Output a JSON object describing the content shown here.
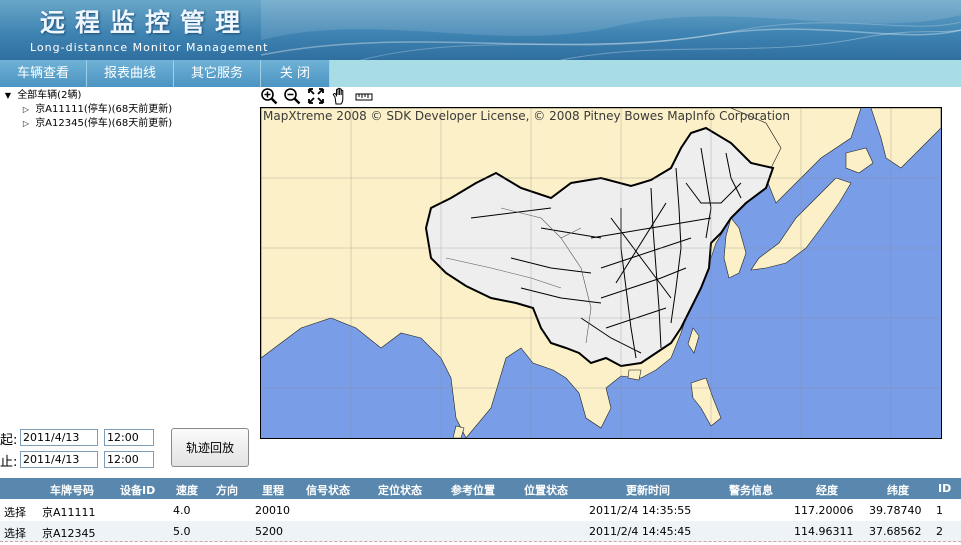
{
  "header": {
    "title": "远程监控管理",
    "subtitle": "Long-distannce Monitor Management"
  },
  "nav": [
    {
      "label": "车辆查看"
    },
    {
      "label": "报表曲线"
    },
    {
      "label": "其它服务"
    },
    {
      "label": "关 闭"
    }
  ],
  "tree": {
    "root": "全部车辆(2辆)",
    "items": [
      {
        "label": "京A11111(停车)(68天前更新)"
      },
      {
        "label": "京A12345(停车)(68天前更新)"
      }
    ]
  },
  "map": {
    "credit": "MapXtreme 2008 © SDK Developer License, © 2008 Pitney Bowes MapInfo Corporation",
    "tools": [
      "zoom-in-icon",
      "zoom-out-icon",
      "full-extent-icon",
      "pan-hand-icon",
      "ruler-icon"
    ],
    "colors": {
      "sea": "#7a9de8",
      "land": "#fbf0c8",
      "china": "#eeeeee"
    }
  },
  "form": {
    "start_label": "起:",
    "end_label": "止:",
    "start_date": "2011/4/13",
    "start_time": "12:00",
    "end_date": "2011/4/13",
    "end_time": "12:00",
    "play_label": "轨迹回放"
  },
  "table": {
    "columns": [
      "车牌号码",
      "设备ID",
      "速度",
      "方向",
      "里程",
      "信号状态",
      "定位状态",
      "参考位置",
      "位置状态",
      "更新时间",
      "警务信息",
      "经度",
      "纬度",
      "ID"
    ],
    "rows": [
      {
        "select": "选择",
        "plate": "京A11111",
        "speed": "4.0",
        "mileage": "20010",
        "time": "2011/2/4 14:35:55",
        "lng": "117.20006",
        "lat": "39.78740",
        "id": "1"
      },
      {
        "select": "选择",
        "plate": "京A12345",
        "speed": "5.0",
        "mileage": "5200",
        "time": "2011/2/4 14:45:45",
        "lng": "114.96311",
        "lat": "37.68562",
        "id": "2"
      }
    ]
  }
}
